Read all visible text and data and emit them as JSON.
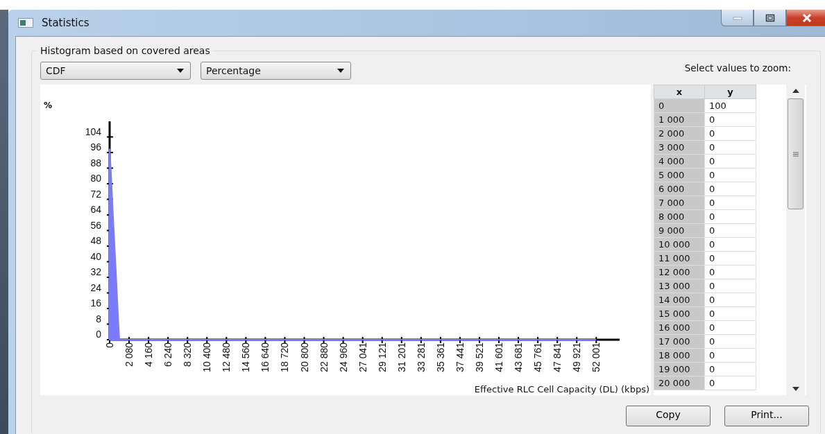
{
  "window": {
    "title": "Statistics"
  },
  "group": {
    "title": "Histogram based on covered areas"
  },
  "dropdowns": [
    {
      "value": "CDF"
    },
    {
      "value": "Percentage"
    }
  ],
  "zoom_label": "Select values to zoom:",
  "chart": {
    "chart_data": {
      "type": "area",
      "ylabel": "%",
      "xlabel": "Effective RLC Cell Capacity (DL) (kbps)",
      "x": [
        0,
        130,
        260,
        390,
        520,
        650,
        780,
        910,
        1040,
        52001
      ],
      "series": [
        {
          "color": "#7b7bff",
          "values": [
            98,
            87,
            74,
            61,
            49,
            37,
            24,
            11,
            0,
            0
          ]
        }
      ],
      "xlim": [
        0,
        54500
      ],
      "ylim": [
        0,
        112
      ],
      "yticks": [
        0,
        8,
        16,
        24,
        32,
        40,
        48,
        56,
        64,
        72,
        80,
        88,
        96,
        104
      ],
      "xticks": [
        {
          "value": 0,
          "label": "0"
        },
        {
          "value": 2080,
          "label": "2 080"
        },
        {
          "value": 4160,
          "label": "4 160"
        },
        {
          "value": 6240,
          "label": "6 240"
        },
        {
          "value": 8320,
          "label": "8 320"
        },
        {
          "value": 10400,
          "label": "10 400"
        },
        {
          "value": 12480,
          "label": "12 480"
        },
        {
          "value": 14560,
          "label": "14 560"
        },
        {
          "value": 16640,
          "label": "16 640"
        },
        {
          "value": 18720,
          "label": "18 720"
        },
        {
          "value": 20800,
          "label": "20 800"
        },
        {
          "value": 22880,
          "label": "22 880"
        },
        {
          "value": 24960,
          "label": "24 960"
        },
        {
          "value": 27041,
          "label": "27 041"
        },
        {
          "value": 29121,
          "label": "29 121"
        },
        {
          "value": 31201,
          "label": "31 201"
        },
        {
          "value": 33281,
          "label": "33 281"
        },
        {
          "value": 35361,
          "label": "35 361"
        },
        {
          "value": 37441,
          "label": "37 441"
        },
        {
          "value": 39521,
          "label": "39 521"
        },
        {
          "value": 41601,
          "label": "41 601"
        },
        {
          "value": 43681,
          "label": "43 681"
        },
        {
          "value": 45761,
          "label": "45 761"
        },
        {
          "value": 47841,
          "label": "47 841"
        },
        {
          "value": 49921,
          "label": "49 921"
        },
        {
          "value": 52001,
          "label": "52 001"
        }
      ]
    }
  },
  "table": {
    "columns": [
      "x",
      "y"
    ],
    "rows": [
      [
        "0",
        "100"
      ],
      [
        "1 000",
        "0"
      ],
      [
        "2 000",
        "0"
      ],
      [
        "3 000",
        "0"
      ],
      [
        "4 000",
        "0"
      ],
      [
        "5 000",
        "0"
      ],
      [
        "6 000",
        "0"
      ],
      [
        "7 000",
        "0"
      ],
      [
        "8 000",
        "0"
      ],
      [
        "9 000",
        "0"
      ],
      [
        "10 000",
        "0"
      ],
      [
        "11 000",
        "0"
      ],
      [
        "12 000",
        "0"
      ],
      [
        "13 000",
        "0"
      ],
      [
        "14 000",
        "0"
      ],
      [
        "15 000",
        "0"
      ],
      [
        "16 000",
        "0"
      ],
      [
        "17 000",
        "0"
      ],
      [
        "18 000",
        "0"
      ],
      [
        "19 000",
        "0"
      ],
      [
        "20 000",
        "0"
      ]
    ]
  },
  "buttons": [
    "Copy",
    "Print..."
  ]
}
